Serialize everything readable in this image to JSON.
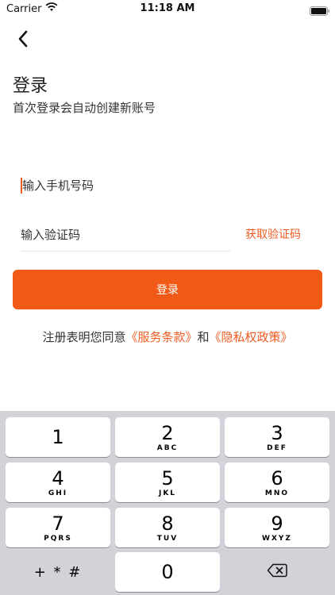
{
  "status_bar": {
    "carrier": "Carrier",
    "time": "11:18 AM"
  },
  "header": {
    "title": "登录",
    "subtitle": "首次登录会自动创建新账号"
  },
  "form": {
    "phone_placeholder": "输入手机号码",
    "code_placeholder": "输入验证码",
    "get_code_label": "获取验证码",
    "login_label": "登录"
  },
  "agreement": {
    "prefix": "注册表明您同意",
    "terms": "《服务条款》",
    "conjunction": "和",
    "privacy": "《隐私权政策》"
  },
  "colors": {
    "accent": "#f15a16",
    "keyboard_bg": "#d1d3d9"
  },
  "keyboard": {
    "keys": [
      {
        "num": "1",
        "letters": ""
      },
      {
        "num": "2",
        "letters": "ABC"
      },
      {
        "num": "3",
        "letters": "DEF"
      },
      {
        "num": "4",
        "letters": "GHI"
      },
      {
        "num": "5",
        "letters": "JKL"
      },
      {
        "num": "6",
        "letters": "MNO"
      },
      {
        "num": "7",
        "letters": "PQRS"
      },
      {
        "num": "8",
        "letters": "TUV"
      },
      {
        "num": "9",
        "letters": "WXYZ"
      }
    ],
    "symbols": "+ * #",
    "zero": "0",
    "delete_icon": "backspace-icon"
  }
}
